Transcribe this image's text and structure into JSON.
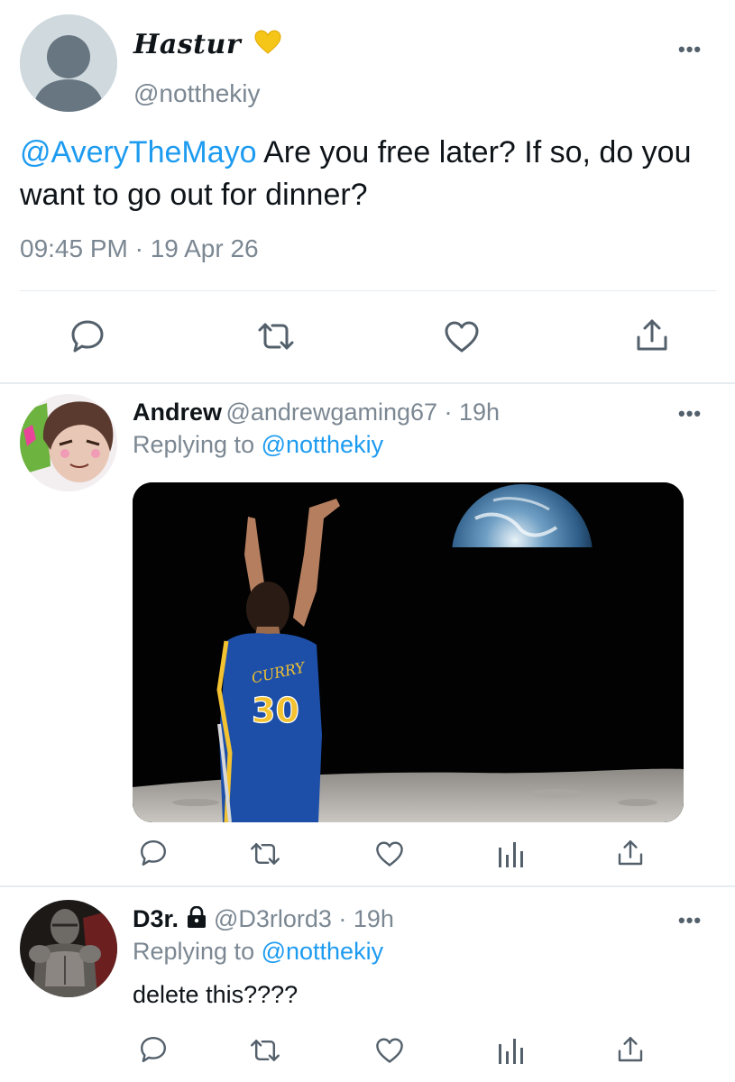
{
  "main_tweet": {
    "display_name": "Hastur",
    "badge": "yellow-heart",
    "handle": "@notthekiy",
    "mention": "@AveryTheMayo",
    "text": " Are you free later? If so, do you want to go out for dinner?",
    "timestamp": "09:45 PM · 19 Apr 26",
    "more": "•••"
  },
  "replies": [
    {
      "display_name": "Andrew",
      "handle": "@andrewgaming67",
      "time": " · 19h",
      "replying_prefix": "Replying to ",
      "replying_to": "@notthekiy",
      "media": {
        "jersey_name": "CURRY",
        "jersey_number": "30"
      },
      "more": "•••"
    },
    {
      "display_name": "D3r.",
      "locked": true,
      "handle": "@D3rlord3",
      "time": " · 19h",
      "replying_prefix": "Replying to ",
      "replying_to": "@notthekiy",
      "text": "delete this????",
      "more": "•••"
    }
  ],
  "icons": {
    "main_actions": [
      "reply-icon",
      "retweet-icon",
      "like-icon",
      "share-icon"
    ],
    "reply_actions": [
      "reply-icon",
      "retweet-icon",
      "like-icon",
      "analytics-icon",
      "share-icon"
    ]
  },
  "colors": {
    "accent": "#1d9bf0",
    "muted": "#7b8792",
    "divider": "#e6ecf0",
    "badge": "#f5c518"
  }
}
